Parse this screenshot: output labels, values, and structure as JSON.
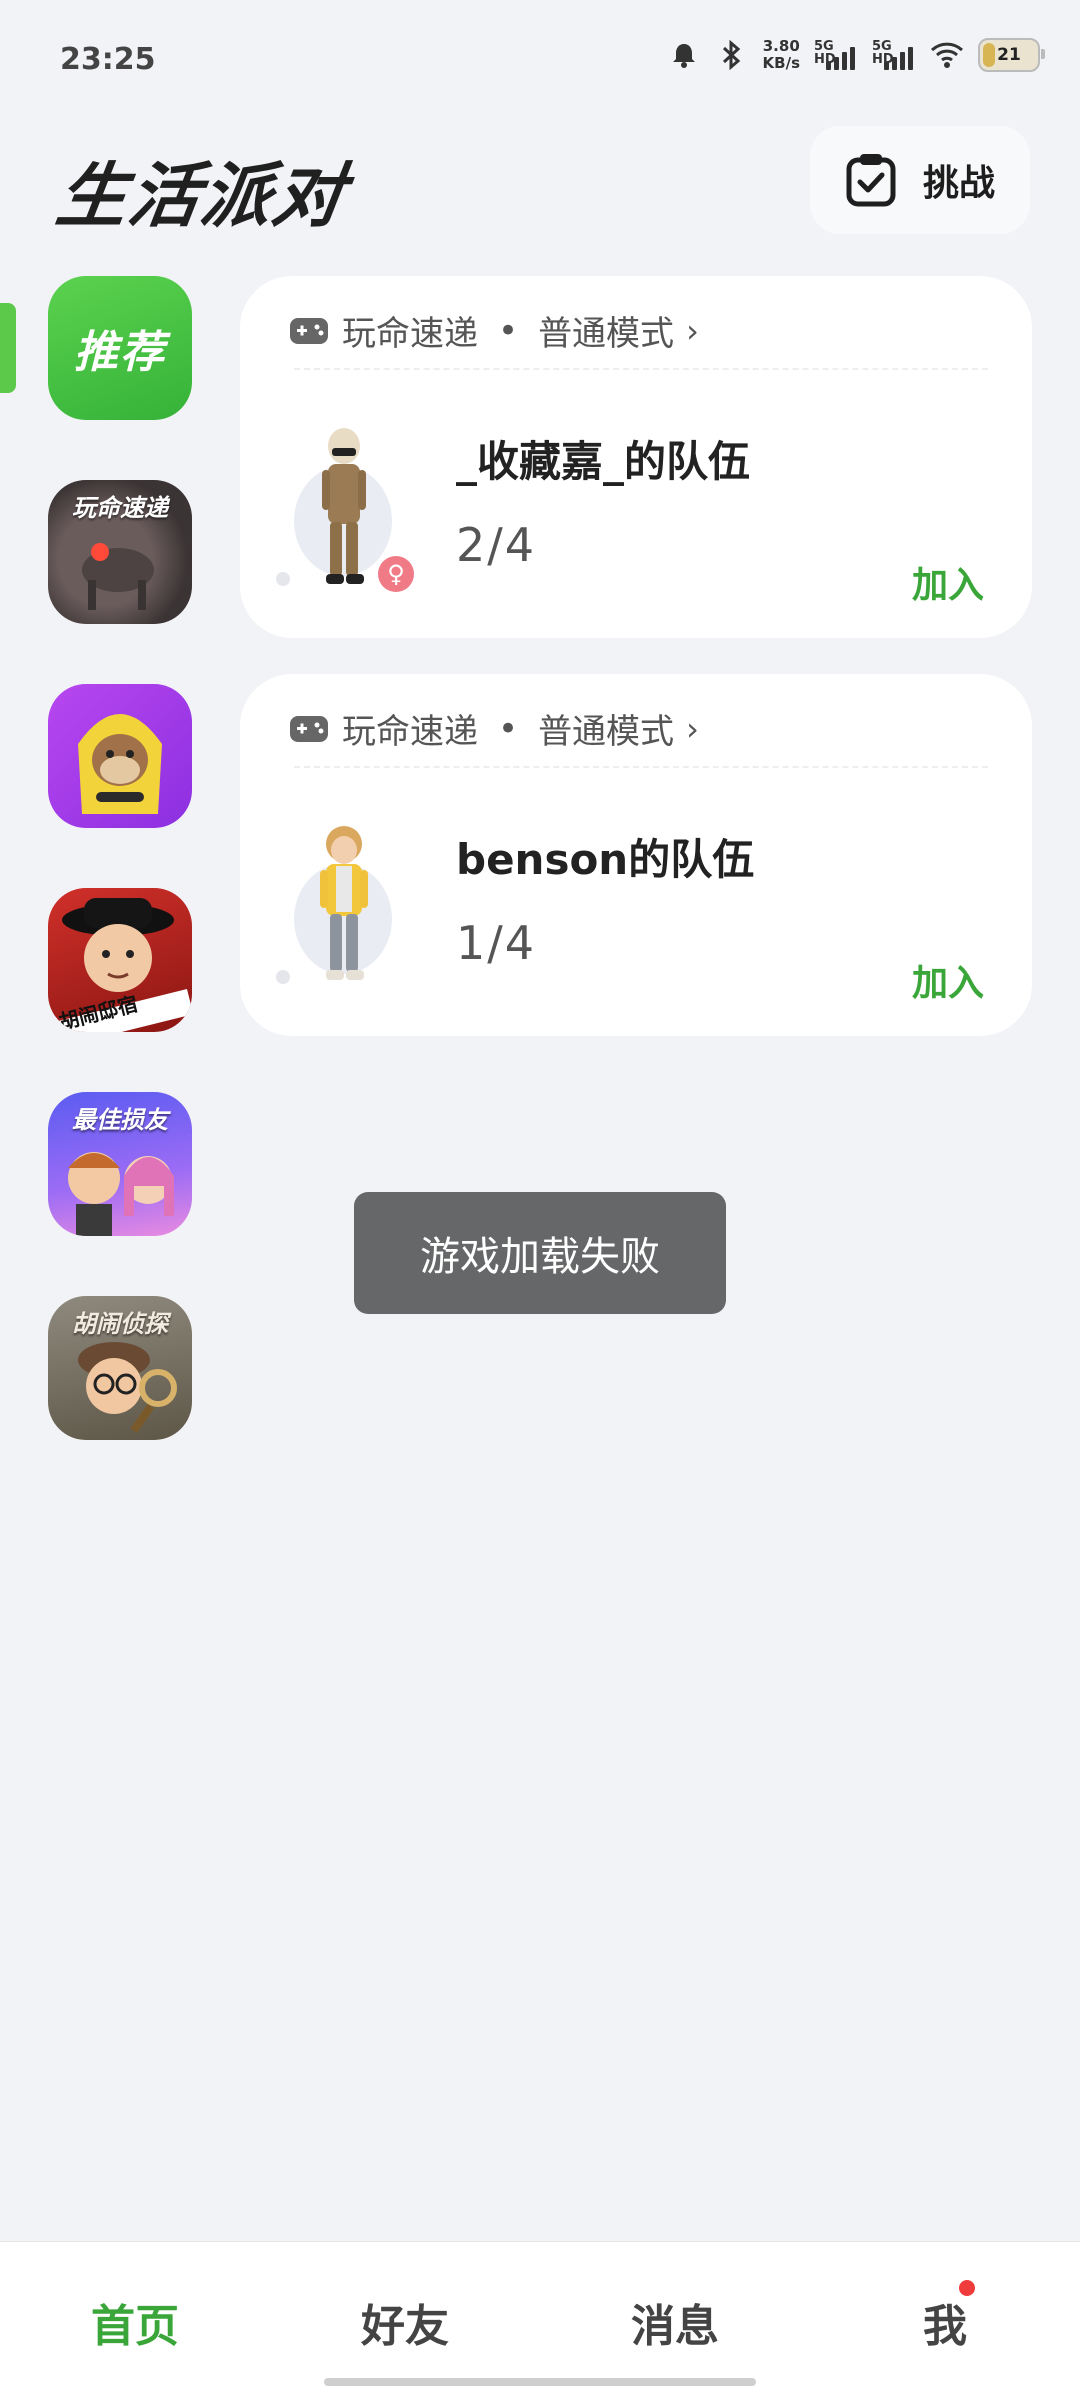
{
  "status_bar": {
    "time": "23:25",
    "net_speed_value": "3.80",
    "net_speed_unit": "KB/s",
    "sim1_label": "5G HD",
    "sim2_label": "5G HD",
    "battery_level": "21"
  },
  "header": {
    "logo_text": "生活派对",
    "challenge_label": "挑战"
  },
  "side_menu": {
    "recommend_label": "推荐",
    "games": [
      {
        "title": "玩命速递"
      },
      {
        "title": ""
      },
      {
        "title": "胡闹邸宿"
      },
      {
        "title": "最佳损友"
      },
      {
        "title": "胡闹侦探"
      }
    ]
  },
  "teams": [
    {
      "game": "玩命速递",
      "mode": "普通模式",
      "name": "_收藏嘉_的队伍",
      "count": "2/4",
      "join_label": "加入",
      "gender_icon": "female-icon"
    },
    {
      "game": "玩命速递",
      "mode": "普通模式",
      "name": "benson的队伍",
      "count": "1/4",
      "join_label": "加入"
    }
  ],
  "toast": {
    "message": "游戏加载失败"
  },
  "bottom_nav": {
    "items": [
      {
        "label": "首页",
        "active": true
      },
      {
        "label": "好友"
      },
      {
        "label": "消息"
      },
      {
        "label": "我",
        "badge": true
      }
    ]
  },
  "colors": {
    "accent_green": "#3aa63a",
    "background": "#f2f3f7",
    "badge_red": "#ef3b3b"
  }
}
